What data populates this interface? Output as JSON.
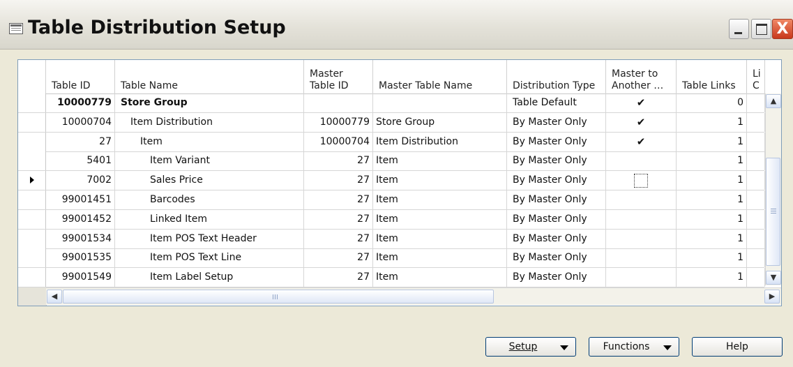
{
  "window": {
    "title": "Table Distribution Setup",
    "close_glyph": "X"
  },
  "columns": [
    "Table ID",
    "Table Name",
    "Master\nTable ID",
    "Master Table Name",
    "Distribution Type",
    "Master to\nAnother …",
    "Table Links",
    "Li\nC"
  ],
  "rows": [
    {
      "table_id": "10000779",
      "table_name": "Store Group",
      "indent": 0,
      "bold": true,
      "master_table_id": "",
      "master_table_name": "",
      "distribution_type": "Table Default",
      "master_to_another": true,
      "table_links": "0",
      "selected": false
    },
    {
      "table_id": "10000704",
      "table_name": "Item Distribution",
      "indent": 1,
      "bold": false,
      "master_table_id": "10000779",
      "master_table_name": "Store Group",
      "distribution_type": "By Master Only",
      "master_to_another": true,
      "table_links": "1",
      "selected": false
    },
    {
      "table_id": "27",
      "table_name": "Item",
      "indent": 2,
      "bold": false,
      "master_table_id": "10000704",
      "master_table_name": "Item Distribution",
      "distribution_type": "By Master Only",
      "master_to_another": true,
      "table_links": "1",
      "selected": false
    },
    {
      "table_id": "5401",
      "table_name": "Item Variant",
      "indent": 3,
      "bold": false,
      "master_table_id": "27",
      "master_table_name": "Item",
      "distribution_type": "By Master Only",
      "master_to_another": false,
      "table_links": "1",
      "selected": false
    },
    {
      "table_id": "7002",
      "table_name": "Sales Price",
      "indent": 3,
      "bold": false,
      "master_table_id": "27",
      "master_table_name": "Item",
      "distribution_type": "By Master Only",
      "master_to_another": false,
      "table_links": "1",
      "selected": true
    },
    {
      "table_id": "99001451",
      "table_name": "Barcodes",
      "indent": 3,
      "bold": false,
      "master_table_id": "27",
      "master_table_name": "Item",
      "distribution_type": "By Master Only",
      "master_to_another": false,
      "table_links": "1",
      "selected": false
    },
    {
      "table_id": "99001452",
      "table_name": "Linked Item",
      "indent": 3,
      "bold": false,
      "master_table_id": "27",
      "master_table_name": "Item",
      "distribution_type": "By Master Only",
      "master_to_another": false,
      "table_links": "1",
      "selected": false
    },
    {
      "table_id": "99001534",
      "table_name": "Item POS Text Header",
      "indent": 3,
      "bold": false,
      "master_table_id": "27",
      "master_table_name": "Item",
      "distribution_type": "By Master Only",
      "master_to_another": false,
      "table_links": "1",
      "selected": false
    },
    {
      "table_id": "99001535",
      "table_name": "Item POS Text Line",
      "indent": 3,
      "bold": false,
      "master_table_id": "27",
      "master_table_name": "Item",
      "distribution_type": "By Master Only",
      "master_to_another": false,
      "table_links": "1",
      "selected": false
    },
    {
      "table_id": "99001549",
      "table_name": "Item Label Setup",
      "indent": 3,
      "bold": false,
      "master_table_id": "27",
      "master_table_name": "Item",
      "distribution_type": "By Master Only",
      "master_to_another": false,
      "table_links": "1",
      "selected": false
    }
  ],
  "check_glyph": "✔",
  "buttons": {
    "setup": "Setup",
    "functions": "Functions",
    "help": "Help"
  },
  "icons": {
    "window": "table-window-icon",
    "scroll_up": "▲",
    "scroll_down": "▼",
    "scroll_left": "◀",
    "scroll_right": "▶"
  }
}
